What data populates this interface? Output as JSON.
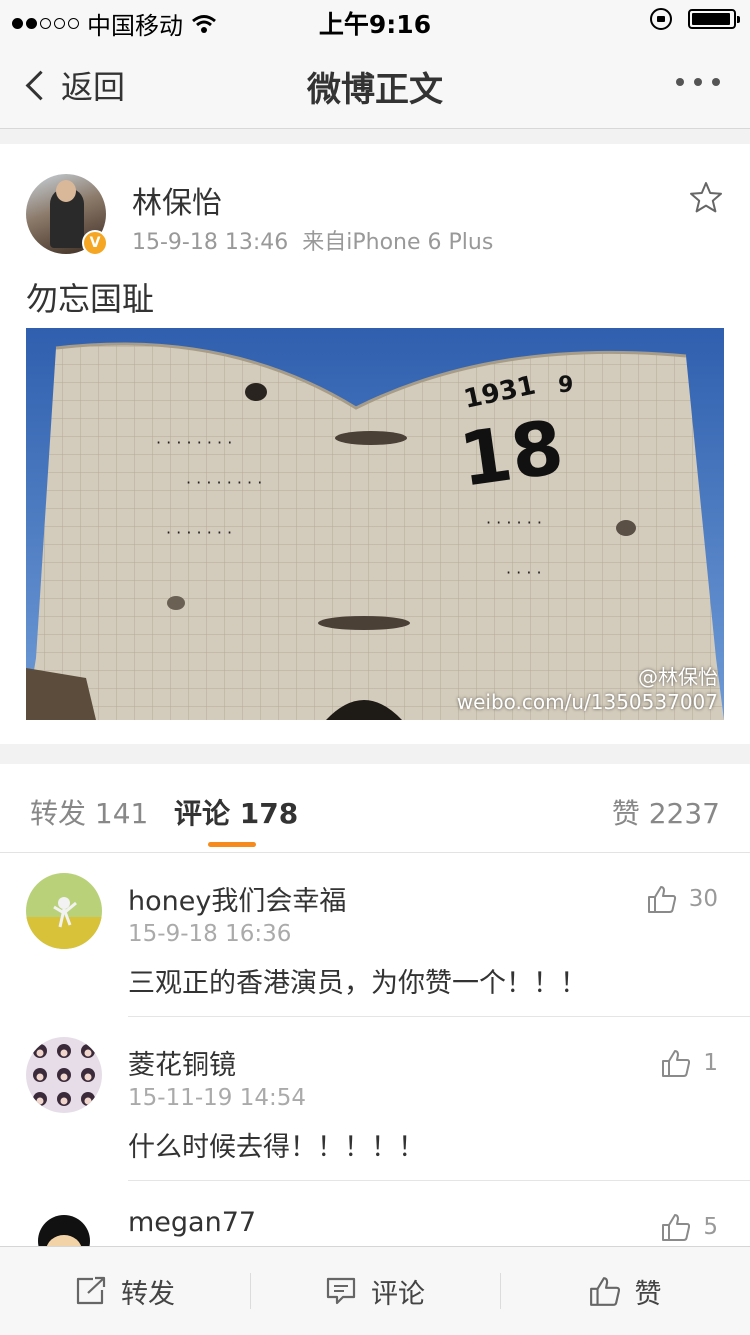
{
  "status_bar": {
    "carrier": "中国移动",
    "time": "上午9:16"
  },
  "nav": {
    "back_label": "返回",
    "title": "微博正文"
  },
  "post": {
    "author": "林保怡",
    "date": "15-9-18 13:46",
    "source": "来自iPhone 6 Plus",
    "verified_badge": "V",
    "text": "勿忘国耻",
    "image_watermark_handle": "@林保怡",
    "image_watermark_url": "weibo.com/u/1350537007"
  },
  "tabs": {
    "repost_label": "转发",
    "repost_count": "141",
    "comment_label": "评论",
    "comment_count": "178",
    "like_label": "赞",
    "like_count": "2237"
  },
  "comments": [
    {
      "name": "honey我们会幸福",
      "time": "15-9-18 16:36",
      "text": "三观正的香港演员，为你赞一个！！！",
      "likes": "30"
    },
    {
      "name": "菱花铜镜",
      "time": "15-11-19 14:54",
      "text": "什么时候去得！！！！！",
      "likes": "1"
    },
    {
      "name": "megan77",
      "time": "",
      "text": "",
      "likes": "5"
    }
  ],
  "toolbar": {
    "repost_label": "转发",
    "comment_label": "评论",
    "like_label": "赞"
  },
  "colors": {
    "accent": "#f78a1d",
    "verified": "#f5a623",
    "sky": "#3f6cb3",
    "stone": "#cfc6b6"
  }
}
